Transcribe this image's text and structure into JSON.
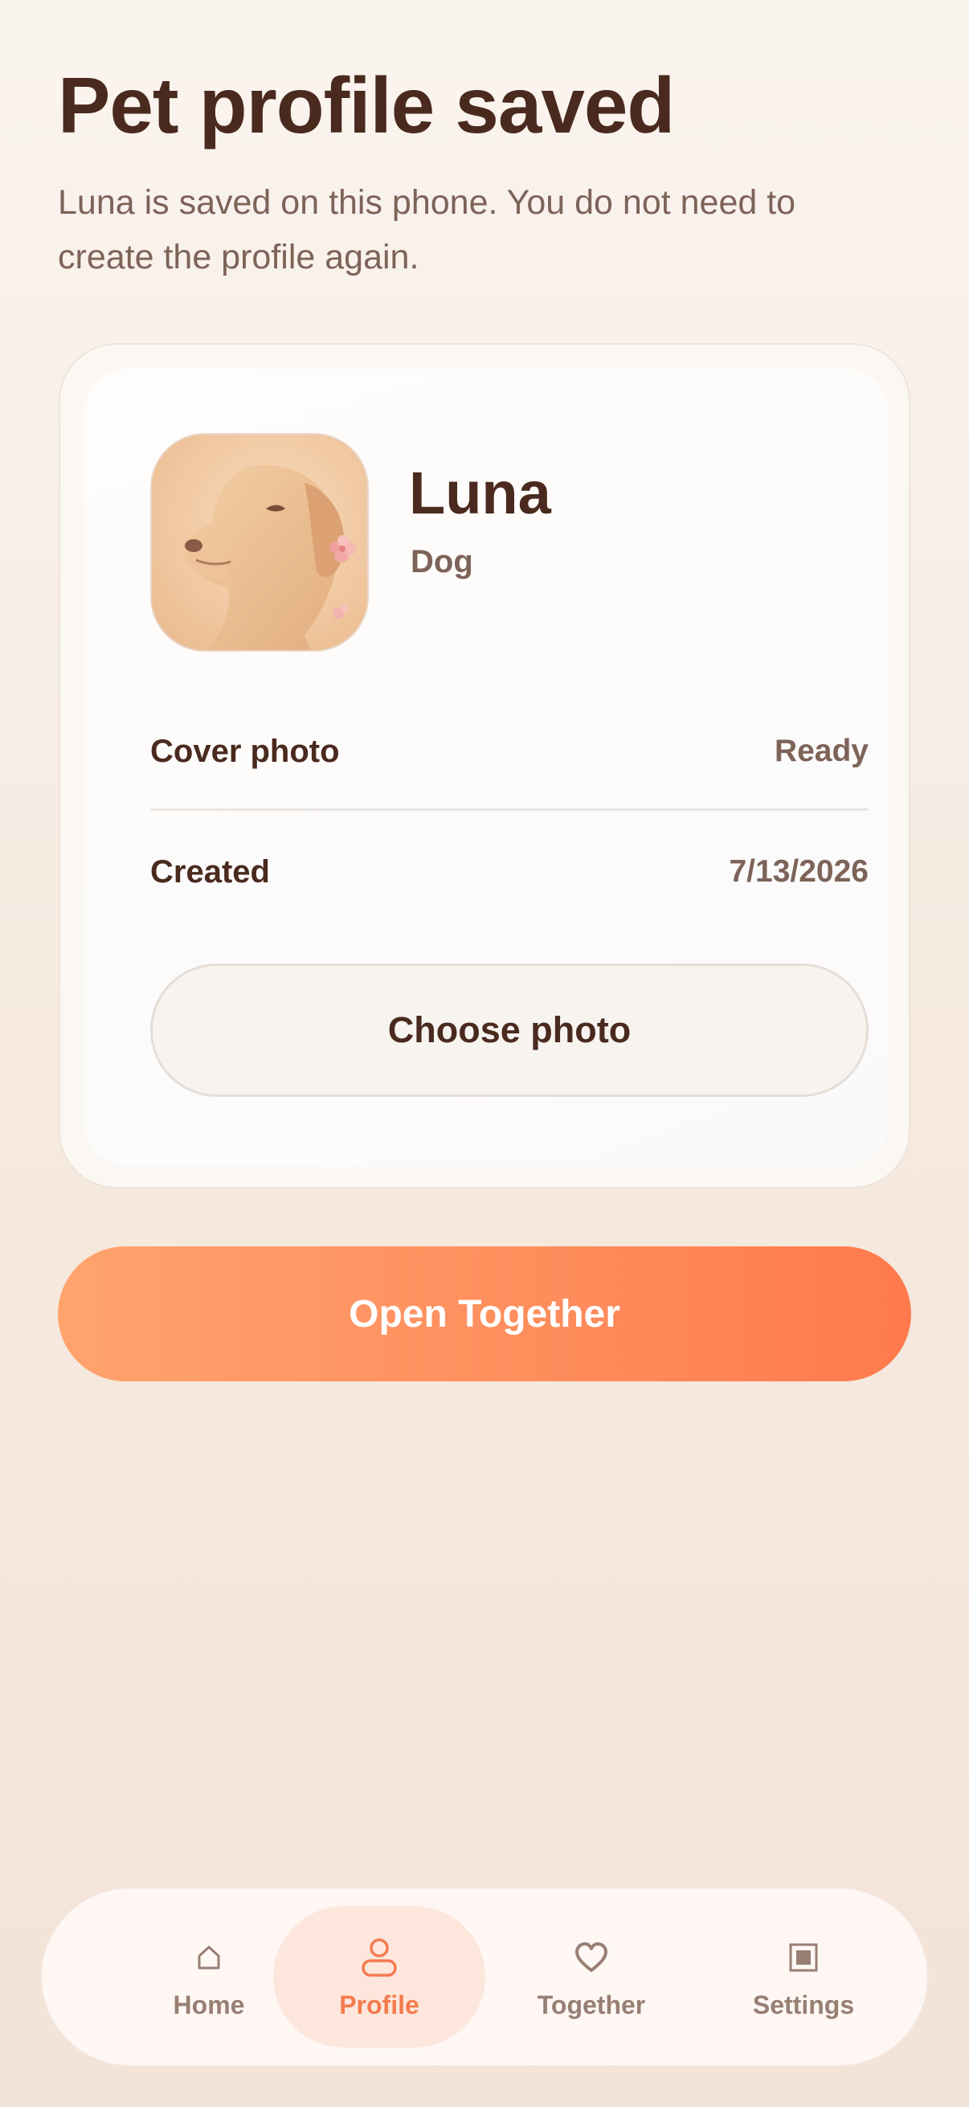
{
  "header": {
    "title": "Pet profile saved",
    "subtitle": "Luna is saved on this phone. You do not need to create the profile again."
  },
  "pet": {
    "name": "Luna",
    "species": "Dog",
    "avatar_icon": "dog-photo"
  },
  "details": [
    {
      "label": "Cover photo",
      "value": "Ready"
    },
    {
      "label": "Created",
      "value": "7/13/2026"
    }
  ],
  "actions": {
    "choose_photo_label": "Choose photo",
    "open_together_label": "Open Together"
  },
  "tabbar": {
    "active": "Profile",
    "items": [
      {
        "label": "Home",
        "icon": "home-icon"
      },
      {
        "label": "Profile",
        "icon": "profile-icon"
      },
      {
        "label": "Together",
        "icon": "heart-icon"
      },
      {
        "label": "Settings",
        "icon": "settings-icon"
      }
    ]
  },
  "colors": {
    "text_primary": "#4a2a1e",
    "text_secondary": "#7d6358",
    "accent": "#ff8e5d",
    "active_tab_bg": "#fde6dc"
  }
}
